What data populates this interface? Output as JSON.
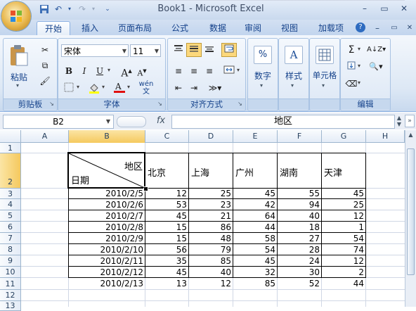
{
  "window": {
    "title": "Book1 - Microsoft Excel"
  },
  "tabs": [
    "开始",
    "插入",
    "页面布局",
    "公式",
    "数据",
    "审阅",
    "视图",
    "加载项"
  ],
  "ribbon": {
    "clipboard": {
      "label": "剪贴板",
      "paste": "粘贴"
    },
    "font": {
      "label": "字体",
      "name": "宋体",
      "size": "11"
    },
    "alignment": {
      "label": "对齐方式"
    },
    "number": {
      "label": "数字",
      "format_btn": "%",
      "btn": "数字"
    },
    "styles": {
      "btn": "样式"
    },
    "cells": {
      "btn": "单元格"
    },
    "editing": {
      "label": "编辑"
    }
  },
  "formula_bar": {
    "name_box": "B2",
    "fx": "fx",
    "content": "地区"
  },
  "columns": [
    "A",
    "B",
    "C",
    "D",
    "E",
    "F",
    "G",
    "H"
  ],
  "rows": [
    "1",
    "2",
    "3",
    "4",
    "5",
    "6",
    "7",
    "8",
    "9",
    "10",
    "11",
    "12",
    "13"
  ],
  "table": {
    "corner_top": "地区",
    "corner_bottom": "日期",
    "headers": [
      "北京",
      "上海",
      "广州",
      "湖南",
      "天津"
    ],
    "data": [
      {
        "date": "2010/2/5",
        "v": [
          "12",
          "25",
          "45",
          "55",
          "45"
        ]
      },
      {
        "date": "2010/2/6",
        "v": [
          "53",
          "23",
          "42",
          "94",
          "25"
        ]
      },
      {
        "date": "2010/2/7",
        "v": [
          "45",
          "21",
          "64",
          "40",
          "12"
        ]
      },
      {
        "date": "2010/2/8",
        "v": [
          "15",
          "86",
          "44",
          "18",
          "1"
        ]
      },
      {
        "date": "2010/2/9",
        "v": [
          "15",
          "48",
          "58",
          "27",
          "54"
        ]
      },
      {
        "date": "2010/2/10",
        "v": [
          "56",
          "79",
          "54",
          "28",
          "74"
        ]
      },
      {
        "date": "2010/2/11",
        "v": [
          "35",
          "85",
          "45",
          "24",
          "12"
        ]
      },
      {
        "date": "2010/2/12",
        "v": [
          "45",
          "40",
          "32",
          "30",
          "2"
        ]
      },
      {
        "date": "2010/2/13",
        "v": [
          "13",
          "12",
          "85",
          "52",
          "44"
        ]
      }
    ]
  },
  "colors": {
    "accent": "#15428b",
    "ribbon_bg": "#dde8f5",
    "header_bg": "#e4ecf7",
    "gridline": "#d0d7e5",
    "selected_header": "#f8d98b"
  }
}
